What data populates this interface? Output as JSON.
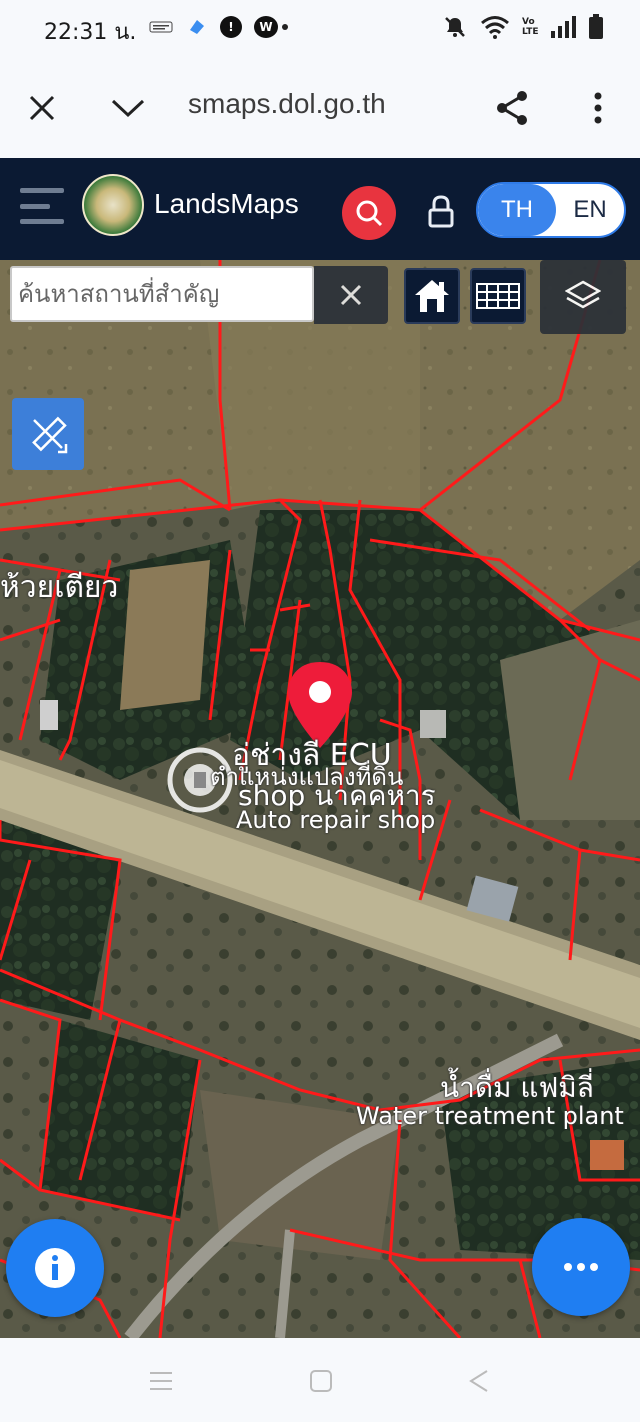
{
  "status_bar": {
    "time": "22:31 น.",
    "app_icons": [
      "grab-merchant-icon",
      "blue-app-icon",
      "alert-icon",
      "w-app-icon"
    ],
    "right_icons": [
      "mute-icon",
      "wifi-icon",
      "volte-icon",
      "signal-icon",
      "battery-icon"
    ],
    "volte_label": "Vo LTE"
  },
  "browser": {
    "url": "landsmaps.dol.go.th",
    "url_visible": "smaps.dol.go.th"
  },
  "header": {
    "brand": "LandsMaps",
    "lang_th": "TH",
    "lang_en": "EN",
    "selected_lang": "TH"
  },
  "map": {
    "search_placeholder": "ค้นหาสถานที่สำคัญ",
    "search_value": "",
    "labels": {
      "village": "ห้วยเตียว",
      "shop_th_1": "อู่ช่างลี ECU",
      "shop_th_2": "shop นาคคหาร",
      "pin_caption": "ตำแหน่งแปลงที่ดิน",
      "shop_en": "Auto repair shop",
      "water_th": "น้ำดื่ม แฟมิลี่",
      "water_en": "Water treatment plant"
    }
  },
  "colors": {
    "header_bg": "#0b1a33",
    "accent_blue": "#1f7ef2",
    "search_red": "#e8343f",
    "parcel_line": "#ff1a1a",
    "pin_red": "#ee1c3a"
  }
}
